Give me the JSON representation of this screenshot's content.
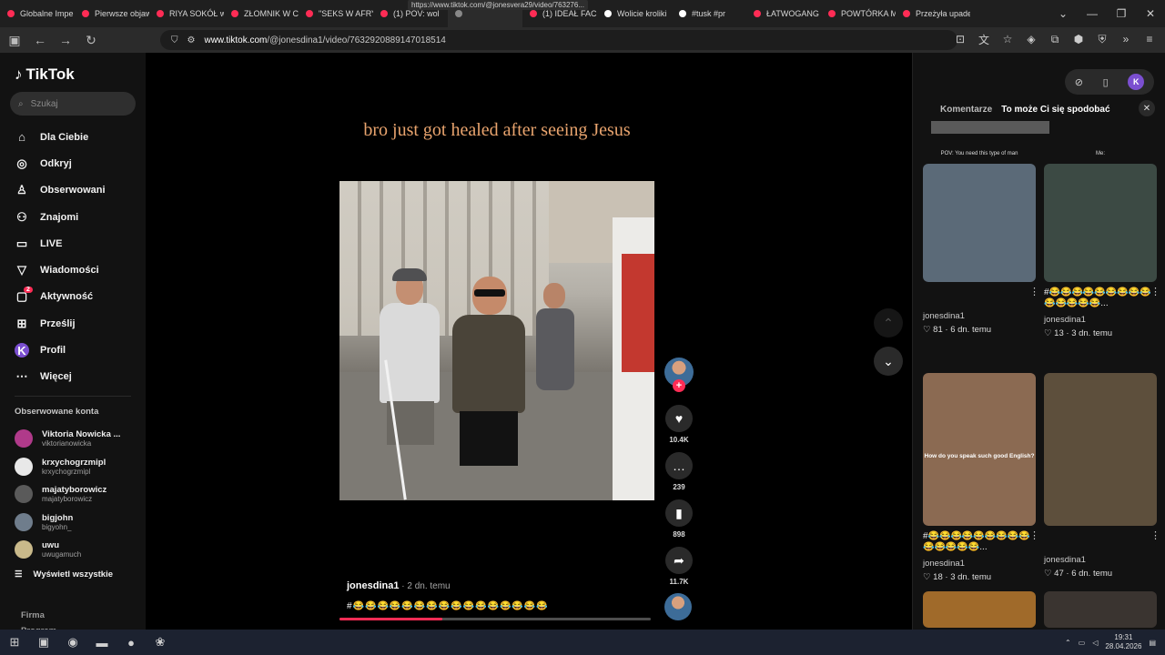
{
  "browser": {
    "tabs": [
      {
        "title": "Globalne Impe",
        "color": "#fe2c55"
      },
      {
        "title": "Pierwsze objaw",
        "color": "#fe2c55"
      },
      {
        "title": "RIYA SOKÓŁ w",
        "color": "#fe2c55"
      },
      {
        "title": "ZŁOMNIK W C",
        "color": "#fe2c55"
      },
      {
        "title": "\"SEKS W AFRYK",
        "color": "#fe2c55"
      },
      {
        "title": "(1) POV: wol",
        "color": "#fe2c55"
      },
      {
        "title": "",
        "color": "#888888"
      },
      {
        "title": "(1) IDEAŁ FACE",
        "color": "#fe2c55"
      },
      {
        "title": "Wolicie kroliki",
        "color": "#ffffff"
      },
      {
        "title": "#tusk #pr",
        "color": "#ffffff"
      },
      {
        "title": "ŁATWOGANG",
        "color": "#fe2c55"
      },
      {
        "title": "POWTÓRKA M",
        "color": "#fe2c55"
      },
      {
        "title": "Przeżyła upadek",
        "color": "#fe2c55"
      }
    ],
    "url_tooltip": "https://www.tiktok.com/@jonesvera29/video/763276...",
    "url_host": "www.tiktok.com",
    "url_path": "/@jonesdina1/video/7632920889147018514"
  },
  "sidebar": {
    "logo": "TikTok",
    "search_placeholder": "Szukaj",
    "menu": [
      {
        "label": "Dla Ciebie",
        "icon": "home-icon",
        "glyph": "⌂"
      },
      {
        "label": "Odkryj",
        "icon": "compass-icon",
        "glyph": "◎"
      },
      {
        "label": "Obserwowani",
        "icon": "following-icon",
        "glyph": "♙"
      },
      {
        "label": "Znajomi",
        "icon": "friends-icon",
        "glyph": "⚇"
      },
      {
        "label": "LIVE",
        "icon": "live-icon",
        "glyph": "▭"
      },
      {
        "label": "Wiadomości",
        "icon": "messages-icon",
        "glyph": "▽"
      },
      {
        "label": "Aktywność",
        "icon": "activity-icon",
        "glyph": "▢",
        "badge": "2"
      },
      {
        "label": "Prześlij",
        "icon": "upload-icon",
        "glyph": "⊞"
      },
      {
        "label": "Profil",
        "icon": "profile-avatar",
        "glyph": "K"
      },
      {
        "label": "Więcej",
        "icon": "more-icon",
        "glyph": "⋯"
      }
    ],
    "followed_title": "Obserwowane konta",
    "followed": [
      {
        "name": "Viktoria Nowicka ...",
        "user": "viktorianowicka",
        "color": "#b03a8a"
      },
      {
        "name": "krxychogrzmipl",
        "user": "krxychogrzmipl",
        "color": "#e8e8e8"
      },
      {
        "name": "majatyborowicz",
        "user": "majatyborowicz",
        "color": "#5a5a5a"
      },
      {
        "name": "bigjohn",
        "user": "bigyohn_",
        "color": "#6f7d8c"
      },
      {
        "name": "uwu",
        "user": "uwugamuch",
        "color": "#c9b98a"
      }
    ],
    "show_all": "Wyświetl wszystkie",
    "footer": [
      "Firma",
      "Program"
    ]
  },
  "video": {
    "caption": "bro just got healed after seeing Jesus",
    "author": "jonesdina1",
    "time": " · 2 dn. temu",
    "description": "#😂😂😂😂😂😂😂😂😂😂😂😂😂😂😂😂",
    "progress": 0.33,
    "likes": "10.4K",
    "comments": "239",
    "saves": "898",
    "shares": "11.7K"
  },
  "right_panel": {
    "tab_comments": "Komentarze",
    "tab_suggested": "To może Ci się spodobać",
    "cards": [
      {
        "overlay": "POV: You need this type of man",
        "title": "",
        "author": "jonesdina1",
        "likes": "81",
        "time": "6 dn. temu",
        "bg": "#5b6a78"
      },
      {
        "overlay": "Me:",
        "title": "#😂😂😂😂😂😂😂😂😂😂😂😂😂😂...",
        "author": "jonesdina1",
        "likes": "13",
        "time": "3 dn. temu",
        "bg": "#3c4a44"
      },
      {
        "overlay": "How do you speak such good English?",
        "title": "#😂😂😂😂😂😂😂😂😂😂😂😂😂😂...",
        "author": "jonesdina1",
        "likes": "18",
        "time": "3 dn. temu",
        "bg": "#8b6a52"
      },
      {
        "overlay": "",
        "title": "",
        "author": "jonesdina1",
        "likes": "47",
        "time": "6 dn. temu",
        "bg": "#5d4f3c"
      },
      {
        "overlay": "",
        "title": "",
        "author": "",
        "likes": "",
        "time": "",
        "bg": "#a06a2a"
      },
      {
        "overlay": "",
        "title": "",
        "author": "",
        "likes": "",
        "time": "",
        "bg": "#3a3430"
      }
    ]
  },
  "taskbar": {
    "time": "19:31",
    "date": "28.04.2026"
  }
}
